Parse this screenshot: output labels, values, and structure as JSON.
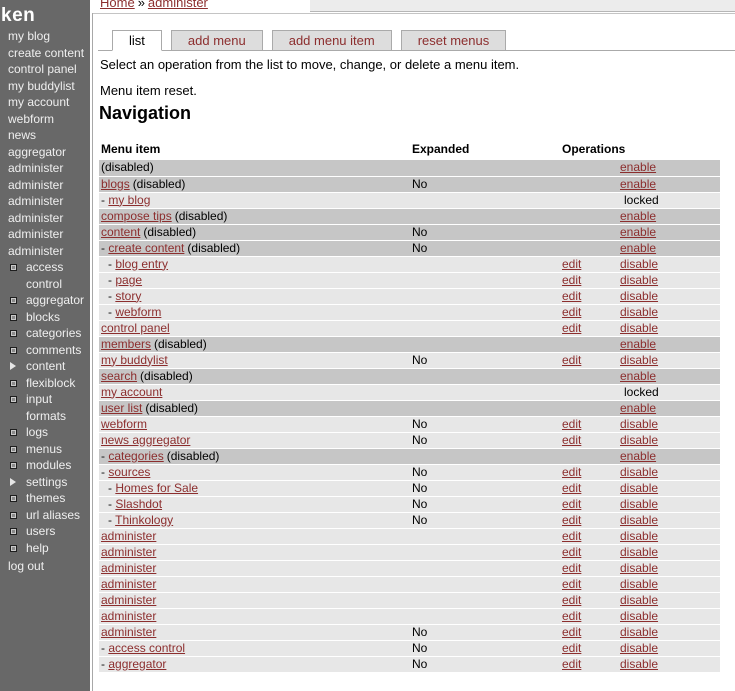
{
  "colors": {
    "accent_link": "#8c2e2e",
    "sidebar_bg": "#686868",
    "row_enabled_bg": "#e7e7e7",
    "row_disabled_bg": "#c6c6c6"
  },
  "sidebar": {
    "site_name": "ken",
    "items": [
      {
        "label": "my blog",
        "icon": "none"
      },
      {
        "label": "create content",
        "icon": "none"
      },
      {
        "label": "control panel",
        "icon": "none"
      },
      {
        "label": "my buddylist",
        "icon": "none"
      },
      {
        "label": "my account",
        "icon": "none"
      },
      {
        "label": "webform",
        "icon": "none"
      },
      {
        "label": "news aggregator",
        "icon": "none"
      },
      {
        "label": "administer",
        "icon": "none"
      },
      {
        "label": "administer",
        "icon": "none"
      },
      {
        "label": "administer",
        "icon": "none"
      },
      {
        "label": "administer",
        "icon": "none"
      },
      {
        "label": "administer",
        "icon": "none"
      },
      {
        "label": "administer",
        "icon": "none"
      },
      {
        "label": "access control",
        "icon": "square"
      },
      {
        "label": "aggregator",
        "icon": "square"
      },
      {
        "label": "blocks",
        "icon": "square"
      },
      {
        "label": "categories",
        "icon": "square"
      },
      {
        "label": "comments",
        "icon": "square"
      },
      {
        "label": "content",
        "icon": "triangle"
      },
      {
        "label": "flexiblock",
        "icon": "square"
      },
      {
        "label": "input formats",
        "icon": "square"
      },
      {
        "label": "logs",
        "icon": "square"
      },
      {
        "label": "menus",
        "icon": "square"
      },
      {
        "label": "modules",
        "icon": "square"
      },
      {
        "label": "settings",
        "icon": "triangle"
      },
      {
        "label": "themes",
        "icon": "square"
      },
      {
        "label": "url aliases",
        "icon": "square"
      },
      {
        "label": "users",
        "icon": "square"
      },
      {
        "label": "help",
        "icon": "square"
      }
    ],
    "logout_label": "log out"
  },
  "breadcrumb": {
    "separator": "»",
    "items": [
      {
        "label": "Home"
      },
      {
        "label": "administer"
      }
    ]
  },
  "tabs": [
    {
      "label": "list",
      "active": true
    },
    {
      "label": "add menu",
      "active": false
    },
    {
      "label": "add menu item",
      "active": false
    },
    {
      "label": "reset menus",
      "active": false
    }
  ],
  "intro_text": "Select an operation from the list to move, change, or delete a menu item.",
  "status_text": "Menu item reset.",
  "page_title": "Navigation",
  "table": {
    "headers": {
      "menu_item": "Menu item",
      "expanded": "Expanded",
      "operations": "Operations"
    },
    "dash_prefix": "-",
    "rows": [
      {
        "label": "",
        "suffix": "(disabled)",
        "depth": 0,
        "expanded": "",
        "edit": "",
        "op": "enable",
        "state": "disabled"
      },
      {
        "label": "blogs",
        "suffix": "(disabled)",
        "depth": 0,
        "expanded": "No",
        "edit": "",
        "op": "enable",
        "state": "disabled"
      },
      {
        "label": "my blog",
        "suffix": "",
        "depth": 1,
        "expanded": "",
        "edit": "",
        "op": "locked",
        "state": "normal"
      },
      {
        "label": "compose tips",
        "suffix": "(disabled)",
        "depth": 0,
        "expanded": "",
        "edit": "",
        "op": "enable",
        "state": "disabled"
      },
      {
        "label": "content",
        "suffix": "(disabled)",
        "depth": 0,
        "expanded": "No",
        "edit": "",
        "op": "enable",
        "state": "disabled"
      },
      {
        "label": "create content",
        "suffix": "(disabled)",
        "depth": 1,
        "expanded": "No",
        "edit": "",
        "op": "enable",
        "state": "disabled"
      },
      {
        "label": "blog entry",
        "suffix": "",
        "depth": 2,
        "expanded": "",
        "edit": "edit",
        "op": "disable",
        "state": "normal"
      },
      {
        "label": "page",
        "suffix": "",
        "depth": 2,
        "expanded": "",
        "edit": "edit",
        "op": "disable",
        "state": "normal"
      },
      {
        "label": "story",
        "suffix": "",
        "depth": 2,
        "expanded": "",
        "edit": "edit",
        "op": "disable",
        "state": "normal"
      },
      {
        "label": "webform",
        "suffix": "",
        "depth": 2,
        "expanded": "",
        "edit": "edit",
        "op": "disable",
        "state": "normal"
      },
      {
        "label": "control panel",
        "suffix": "",
        "depth": 0,
        "expanded": "",
        "edit": "edit",
        "op": "disable",
        "state": "normal"
      },
      {
        "label": "members",
        "suffix": "(disabled)",
        "depth": 0,
        "expanded": "",
        "edit": "",
        "op": "enable",
        "state": "disabled"
      },
      {
        "label": "my buddylist",
        "suffix": "",
        "depth": 0,
        "expanded": "No",
        "edit": "edit",
        "op": "disable",
        "state": "normal"
      },
      {
        "label": "search",
        "suffix": "(disabled)",
        "depth": 0,
        "expanded": "",
        "edit": "",
        "op": "enable",
        "state": "disabled"
      },
      {
        "label": "my account",
        "suffix": "",
        "depth": 0,
        "expanded": "",
        "edit": "",
        "op": "locked",
        "state": "normal"
      },
      {
        "label": "user list",
        "suffix": "(disabled)",
        "depth": 0,
        "expanded": "",
        "edit": "",
        "op": "enable",
        "state": "disabled"
      },
      {
        "label": "webform",
        "suffix": "",
        "depth": 0,
        "expanded": "No",
        "edit": "edit",
        "op": "disable",
        "state": "normal"
      },
      {
        "label": "news aggregator",
        "suffix": "",
        "depth": 0,
        "expanded": "No",
        "edit": "edit",
        "op": "disable",
        "state": "normal"
      },
      {
        "label": "categories",
        "suffix": "(disabled)",
        "depth": 1,
        "expanded": "",
        "edit": "",
        "op": "enable",
        "state": "disabled"
      },
      {
        "label": "sources",
        "suffix": "",
        "depth": 1,
        "expanded": "No",
        "edit": "edit",
        "op": "disable",
        "state": "normal"
      },
      {
        "label": "Homes for Sale",
        "suffix": "",
        "depth": 2,
        "expanded": "No",
        "edit": "edit",
        "op": "disable",
        "state": "normal"
      },
      {
        "label": "Slashdot",
        "suffix": "",
        "depth": 2,
        "expanded": "No",
        "edit": "edit",
        "op": "disable",
        "state": "normal"
      },
      {
        "label": "Thinkology",
        "suffix": "",
        "depth": 2,
        "expanded": "No",
        "edit": "edit",
        "op": "disable",
        "state": "normal"
      },
      {
        "label": "administer",
        "suffix": "",
        "depth": 0,
        "expanded": "",
        "edit": "edit",
        "op": "disable",
        "state": "normal"
      },
      {
        "label": "administer",
        "suffix": "",
        "depth": 0,
        "expanded": "",
        "edit": "edit",
        "op": "disable",
        "state": "normal"
      },
      {
        "label": "administer",
        "suffix": "",
        "depth": 0,
        "expanded": "",
        "edit": "edit",
        "op": "disable",
        "state": "normal"
      },
      {
        "label": "administer",
        "suffix": "",
        "depth": 0,
        "expanded": "",
        "edit": "edit",
        "op": "disable",
        "state": "normal"
      },
      {
        "label": "administer",
        "suffix": "",
        "depth": 0,
        "expanded": "",
        "edit": "edit",
        "op": "disable",
        "state": "normal"
      },
      {
        "label": "administer",
        "suffix": "",
        "depth": 0,
        "expanded": "",
        "edit": "edit",
        "op": "disable",
        "state": "normal"
      },
      {
        "label": "administer",
        "suffix": "",
        "depth": 0,
        "expanded": "No",
        "edit": "edit",
        "op": "disable",
        "state": "normal"
      },
      {
        "label": "access control",
        "suffix": "",
        "depth": 1,
        "expanded": "No",
        "edit": "edit",
        "op": "disable",
        "state": "normal"
      },
      {
        "label": "aggregator",
        "suffix": "",
        "depth": 1,
        "expanded": "No",
        "edit": "edit",
        "op": "disable",
        "state": "normal"
      }
    ]
  }
}
